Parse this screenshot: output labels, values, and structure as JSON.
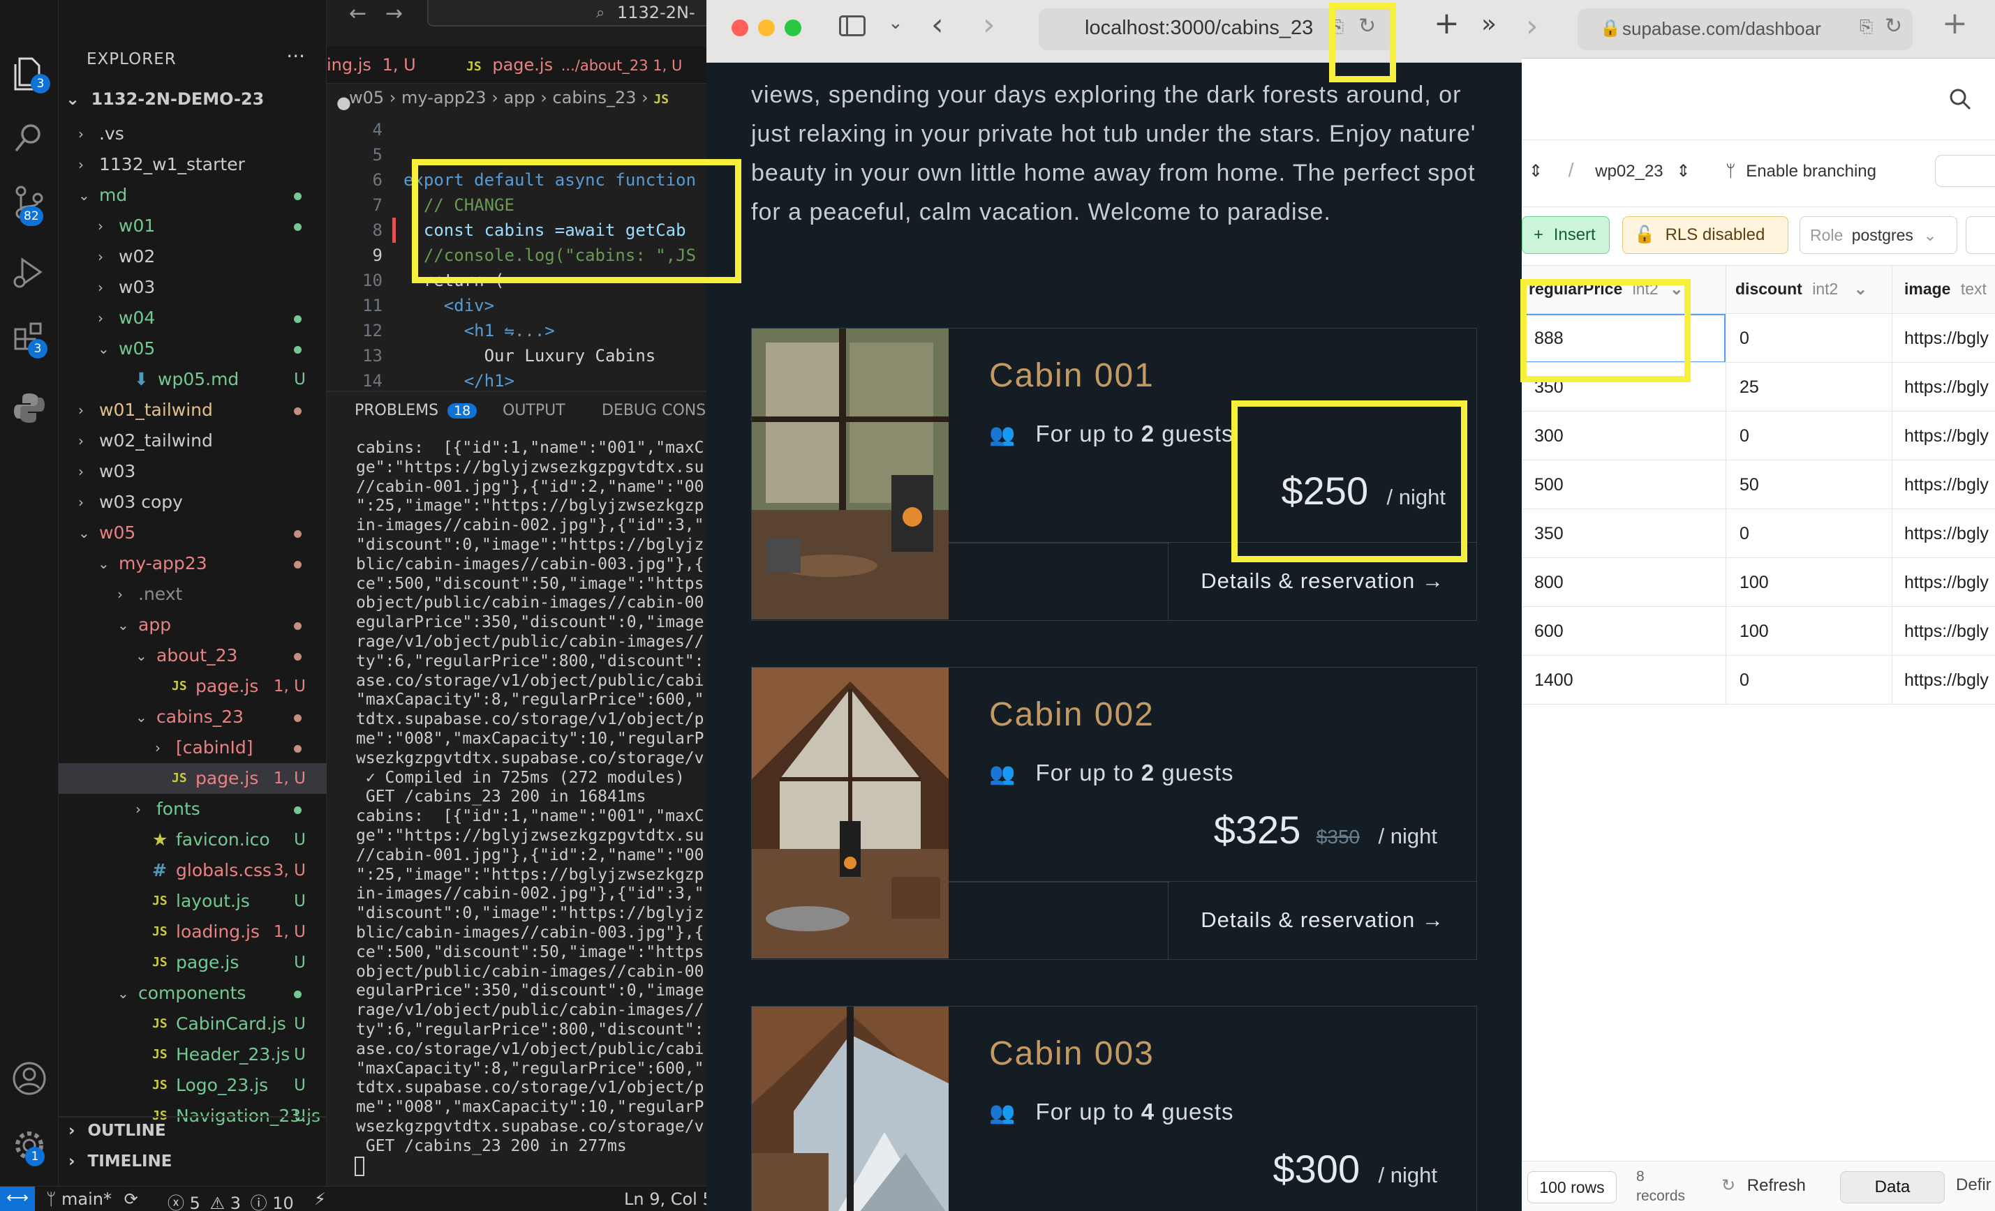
{
  "vscode": {
    "activity_badges": {
      "explorer": "3",
      "source_control": "82",
      "extensions": "3",
      "accounts": "1"
    },
    "explorer_title": "EXPLORER",
    "explorer_more": "···",
    "root": "1132-2N-DEMO-23",
    "tree": [
      {
        "label": ".vs",
        "chev": "›",
        "indent": 0,
        "color": "#cccccc",
        "status": "",
        "dot": ""
      },
      {
        "label": "1132_w1_starter",
        "chev": "›",
        "indent": 0,
        "color": "#cccccc",
        "status": "",
        "dot": ""
      },
      {
        "label": "md",
        "chev": "⌄",
        "indent": 0,
        "color": "#73c991",
        "status": "",
        "dot": "#73c991"
      },
      {
        "label": "w01",
        "chev": "›",
        "indent": 1,
        "color": "#73c991",
        "status": "",
        "dot": "#73c991"
      },
      {
        "label": "w02",
        "chev": "›",
        "indent": 1,
        "color": "#cccccc",
        "status": "",
        "dot": ""
      },
      {
        "label": "w03",
        "chev": "›",
        "indent": 1,
        "color": "#cccccc",
        "status": "",
        "dot": ""
      },
      {
        "label": "w04",
        "chev": "›",
        "indent": 1,
        "color": "#73c991",
        "status": "",
        "dot": "#73c991"
      },
      {
        "label": "w05",
        "chev": "⌄",
        "indent": 1,
        "color": "#73c991",
        "status": "",
        "dot": "#73c991"
      },
      {
        "label": "wp05.md",
        "chev": "",
        "indent": 2,
        "color": "#73c991",
        "status": "U",
        "dot": "",
        "icon": "md"
      },
      {
        "label": "w01_tailwind",
        "chev": "›",
        "indent": 0,
        "color": "#e2c08d",
        "status": "",
        "dot": "#c58f7b"
      },
      {
        "label": "w02_tailwind",
        "chev": "›",
        "indent": 0,
        "color": "#cccccc",
        "status": "",
        "dot": ""
      },
      {
        "label": "w03",
        "chev": "›",
        "indent": 0,
        "color": "#cccccc",
        "status": "",
        "dot": ""
      },
      {
        "label": "w03 copy",
        "chev": "›",
        "indent": 0,
        "color": "#cccccc",
        "status": "",
        "dot": ""
      },
      {
        "label": "w05",
        "chev": "⌄",
        "indent": 0,
        "color": "#e98282",
        "status": "",
        "dot": "#c58f7b"
      },
      {
        "label": "my-app23",
        "chev": "⌄",
        "indent": 1,
        "color": "#e98282",
        "status": "",
        "dot": "#c58f7b"
      },
      {
        "label": ".next",
        "chev": "›",
        "indent": 2,
        "color": "#8c8c8c",
        "status": "",
        "dot": ""
      },
      {
        "label": "app",
        "chev": "⌄",
        "indent": 2,
        "color": "#e98282",
        "status": "",
        "dot": "#c58f7b"
      },
      {
        "label": "about_23",
        "chev": "⌄",
        "indent": 3,
        "color": "#e98282",
        "status": "",
        "dot": "#c58f7b"
      },
      {
        "label": "page.js",
        "chev": "",
        "indent": 4,
        "color": "#e98282",
        "status": "1, U",
        "dot": "",
        "icon": "js"
      },
      {
        "label": "cabins_23",
        "chev": "⌄",
        "indent": 3,
        "color": "#e98282",
        "status": "",
        "dot": "#c58f7b"
      },
      {
        "label": "[cabinId]",
        "chev": "›",
        "indent": 4,
        "color": "#e98282",
        "status": "",
        "dot": "#c58f7b"
      },
      {
        "label": "page.js",
        "chev": "",
        "indent": 4,
        "color": "#e98282",
        "status": "1, U",
        "dot": "",
        "icon": "js",
        "selected": true
      },
      {
        "label": "fonts",
        "chev": "›",
        "indent": 3,
        "color": "#73c991",
        "status": "",
        "dot": "#73c991"
      },
      {
        "label": "favicon.ico",
        "chev": "",
        "indent": 3,
        "color": "#73c991",
        "status": "U",
        "dot": "",
        "icon": "star"
      },
      {
        "label": "globals.css",
        "chev": "",
        "indent": 3,
        "color": "#e98282",
        "status": "3, U",
        "dot": "",
        "icon": "css"
      },
      {
        "label": "layout.js",
        "chev": "",
        "indent": 3,
        "color": "#73c991",
        "status": "U",
        "dot": "",
        "icon": "js"
      },
      {
        "label": "loading.js",
        "chev": "",
        "indent": 3,
        "color": "#e98282",
        "status": "1, U",
        "dot": "",
        "icon": "js"
      },
      {
        "label": "page.js",
        "chev": "",
        "indent": 3,
        "color": "#73c991",
        "status": "U",
        "dot": "",
        "icon": "js"
      },
      {
        "label": "components",
        "chev": "⌄",
        "indent": 2,
        "color": "#73c991",
        "status": "",
        "dot": "#73c991"
      },
      {
        "label": "CabinCard.js",
        "chev": "",
        "indent": 3,
        "color": "#73c991",
        "status": "U",
        "dot": "",
        "icon": "js"
      },
      {
        "label": "Header_23.js",
        "chev": "",
        "indent": 3,
        "color": "#73c991",
        "status": "U",
        "dot": "",
        "icon": "js"
      },
      {
        "label": "Logo_23.js",
        "chev": "",
        "indent": 3,
        "color": "#73c991",
        "status": "U",
        "dot": "",
        "icon": "js"
      },
      {
        "label": "Navigation_23.js",
        "chev": "",
        "indent": 3,
        "color": "#73c991",
        "status": "U",
        "dot": "",
        "icon": "js"
      }
    ],
    "outline": "OUTLINE",
    "timeline": "TIMELINE",
    "tabs": [
      {
        "label": "ing.js",
        "detail": "1, U"
      },
      {
        "label": "page.js",
        "detail": ".../about_23 1, U"
      }
    ],
    "search_text": "1132-2N-",
    "breadcrumb": [
      "w05",
      "my-app23",
      "app",
      "cabins_23",
      "JS"
    ],
    "code": [
      {
        "n": "4",
        "text": ""
      },
      {
        "n": "5",
        "text": ""
      },
      {
        "n": "6",
        "text": "export default async function"
      },
      {
        "n": "7",
        "text": "  // CHANGE"
      },
      {
        "n": "8",
        "text": "  const cabins =await getCab"
      },
      {
        "n": "9",
        "text": "  //console.log(\"cabins: \",JS"
      },
      {
        "n": "10",
        "text": "  return ("
      },
      {
        "n": "11",
        "text": "    <div>"
      },
      {
        "n": "12",
        "text": "      <h1 ⇋...>"
      },
      {
        "n": "13",
        "text": "        Our Luxury Cabins"
      },
      {
        "n": "14",
        "text": "      </h1>"
      }
    ],
    "panel_tabs": {
      "problems": "PROBLEMS",
      "problems_count": "18",
      "output": "OUTPUT",
      "debug": "DEBUG CONSO"
    },
    "terminal": [
      "cabins:  [{\"id\":1,\"name\":\"001\",\"maxC",
      "ge\":\"https://bglyjzwsezkgzpgvtdtx.su",
      "//cabin-001.jpg\"},{\"id\":2,\"name\":\"00",
      "\":25,\"image\":\"https://bglyjzwsezkgzp",
      "in-images//cabin-002.jpg\"},{\"id\":3,\"",
      "\"discount\":0,\"image\":\"https://bglyjz",
      "blic/cabin-images//cabin-003.jpg\"},{",
      "ce\":500,\"discount\":50,\"image\":\"https",
      "object/public/cabin-images//cabin-00",
      "egularPrice\":350,\"discount\":0,\"image",
      "rage/v1/object/public/cabin-images//",
      "ty\":6,\"regularPrice\":800,\"discount\":",
      "ase.co/storage/v1/object/public/cabi",
      "\"maxCapacity\":8,\"regularPrice\":600,\"",
      "tdtx.supabase.co/storage/v1/object/p",
      "me\":\"008\",\"maxCapacity\":10,\"regularP",
      "wsezkgzpgvtdtx.supabase.co/storage/v",
      " ✓ Compiled in 725ms (272 modules)",
      " GET /cabins_23 200 in 16841ms",
      "cabins:  [{\"id\":1,\"name\":\"001\",\"maxC",
      "ge\":\"https://bglyjzwsezkgzpgvtdtx.su",
      "//cabin-001.jpg\"},{\"id\":2,\"name\":\"00",
      "\":25,\"image\":\"https://bglyjzwsezkgzp",
      "in-images//cabin-002.jpg\"},{\"id\":3,\"",
      "\"discount\":0,\"image\":\"https://bglyjz",
      "blic/cabin-images//cabin-003.jpg\"},{",
      "ce\":500,\"discount\":50,\"image\":\"https",
      "object/public/cabin-images//cabin-00",
      "egularPrice\":350,\"discount\":0,\"image",
      "rage/v1/object/public/cabin-images//",
      "ty\":6,\"regularPrice\":800,\"discount\":",
      "ase.co/storage/v1/object/public/cabi",
      "\"maxCapacity\":8,\"regularPrice\":600,\"",
      "tdtx.supabase.co/storage/v1/object/p",
      "me\":\"008\",\"maxCapacity\":10,\"regularP",
      "wsezkgzpgvtdtx.supabase.co/storage/v",
      " GET /cabins_23 200 in 277ms"
    ],
    "status": {
      "branch": "main*",
      "errors": "5",
      "warnings": "3",
      "info": "10",
      "position": "Ln 9, Col 5"
    }
  },
  "browser": {
    "url": "localhost:3000/cabins_23",
    "intro": "views, spending your days exploring the dark forests around, or just relaxing in your private hot tub under the stars. Enjoy nature' beauty in your own little home away from home. The perfect spot for a peaceful, calm vacation. Welcome to paradise.",
    "cabins": [
      {
        "name": "Cabin 001",
        "guests_prefix": "For up to ",
        "guests_num": "2",
        "guests_suffix": " guests",
        "price": "$250",
        "old": "",
        "night": "/ night",
        "details": "Details & reservation →"
      },
      {
        "name": "Cabin 002",
        "guests_prefix": "For up to ",
        "guests_num": "2",
        "guests_suffix": " guests",
        "price": "$325",
        "old": "$350",
        "night": "/ night",
        "details": "Details & reservation →"
      },
      {
        "name": "Cabin 003",
        "guests_prefix": "For up to ",
        "guests_num": "4",
        "guests_suffix": " guests",
        "price": "$300",
        "old": "",
        "night": "/ night",
        "details": ""
      }
    ]
  },
  "supabase": {
    "url": "supabase.com/dashboar",
    "project": "wp02_23",
    "branching": "Enable branching",
    "insert": "Insert",
    "rls": "RLS disabled",
    "role_label": "Role",
    "role": "postgres",
    "columns": [
      {
        "name": "regularPrice",
        "type": "int2"
      },
      {
        "name": "discount",
        "type": "int2"
      },
      {
        "name": "image",
        "type": "text"
      }
    ],
    "rows": [
      {
        "price": "888",
        "discount": "0",
        "image": "https://bgly"
      },
      {
        "price": "350",
        "discount": "25",
        "image": "https://bgly"
      },
      {
        "price": "300",
        "discount": "0",
        "image": "https://bgly"
      },
      {
        "price": "500",
        "discount": "50",
        "image": "https://bgly"
      },
      {
        "price": "350",
        "discount": "0",
        "image": "https://bgly"
      },
      {
        "price": "800",
        "discount": "100",
        "image": "https://bgly"
      },
      {
        "price": "600",
        "discount": "100",
        "image": "https://bgly"
      },
      {
        "price": "1400",
        "discount": "0",
        "image": "https://bgly"
      }
    ],
    "footer": {
      "rows_select": "100 rows",
      "records_count": "8",
      "records_label": "records",
      "refresh": "Refresh",
      "data_tab": "Data",
      "definition_tab": "Defir"
    }
  },
  "colors": {
    "highlight": "#f6f03a",
    "cabin_gold": "#c69963",
    "browser_bg": "#141c24",
    "vscode_accent": "#0f72d6"
  }
}
